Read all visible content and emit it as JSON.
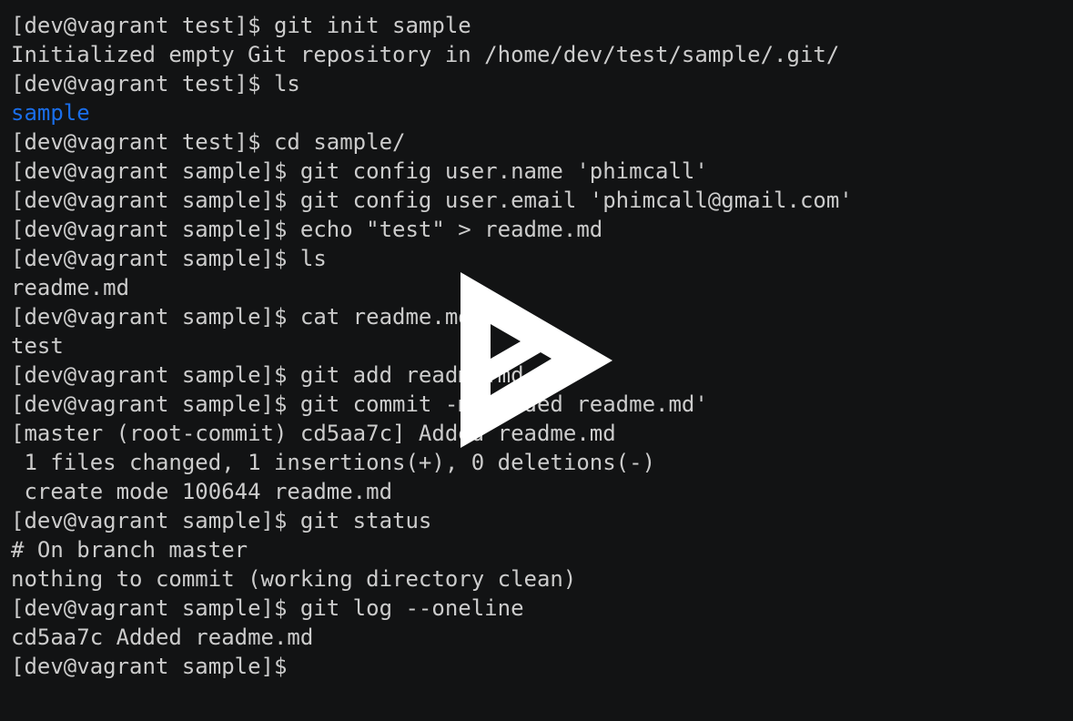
{
  "terminal": {
    "lines": [
      {
        "text": "[dev@vagrant test]$ git init sample",
        "kind": "prompt"
      },
      {
        "text": "Initialized empty Git repository in /home/dev/test/sample/.git/",
        "kind": "output"
      },
      {
        "text": "[dev@vagrant test]$ ls",
        "kind": "prompt"
      },
      {
        "text": "sample",
        "kind": "dir"
      },
      {
        "text": "[dev@vagrant test]$ cd sample/",
        "kind": "prompt"
      },
      {
        "text": "[dev@vagrant sample]$ git config user.name 'phimcall'",
        "kind": "prompt"
      },
      {
        "text": "[dev@vagrant sample]$ git config user.email 'phimcall@gmail.com'",
        "kind": "prompt"
      },
      {
        "text": "[dev@vagrant sample]$ echo \"test\" > readme.md",
        "kind": "prompt"
      },
      {
        "text": "[dev@vagrant sample]$ ls",
        "kind": "prompt"
      },
      {
        "text": "readme.md",
        "kind": "output"
      },
      {
        "text": "[dev@vagrant sample]$ cat readme.md",
        "kind": "prompt"
      },
      {
        "text": "test",
        "kind": "output"
      },
      {
        "text": "[dev@vagrant sample]$ git add readme.md",
        "kind": "prompt"
      },
      {
        "text": "[dev@vagrant sample]$ git commit -m 'Added readme.md'",
        "kind": "prompt"
      },
      {
        "text": "[master (root-commit) cd5aa7c] Added readme.md",
        "kind": "output"
      },
      {
        "text": " 1 files changed, 1 insertions(+), 0 deletions(-)",
        "kind": "output"
      },
      {
        "text": " create mode 100644 readme.md",
        "kind": "output"
      },
      {
        "text": "[dev@vagrant sample]$ git status",
        "kind": "prompt"
      },
      {
        "text": "# On branch master",
        "kind": "output"
      },
      {
        "text": "nothing to commit (working directory clean)",
        "kind": "output"
      },
      {
        "text": "[dev@vagrant sample]$ git log --oneline",
        "kind": "prompt"
      },
      {
        "text": "cd5aa7c Added readme.md",
        "kind": "output"
      },
      {
        "text": "[dev@vagrant sample]$",
        "kind": "prompt"
      }
    ]
  },
  "colors": {
    "background": "#121314",
    "foreground": "#cccccc",
    "directory": "#1a6eea",
    "play_button": "#ffffff"
  },
  "overlay": {
    "icon": "play-icon"
  }
}
